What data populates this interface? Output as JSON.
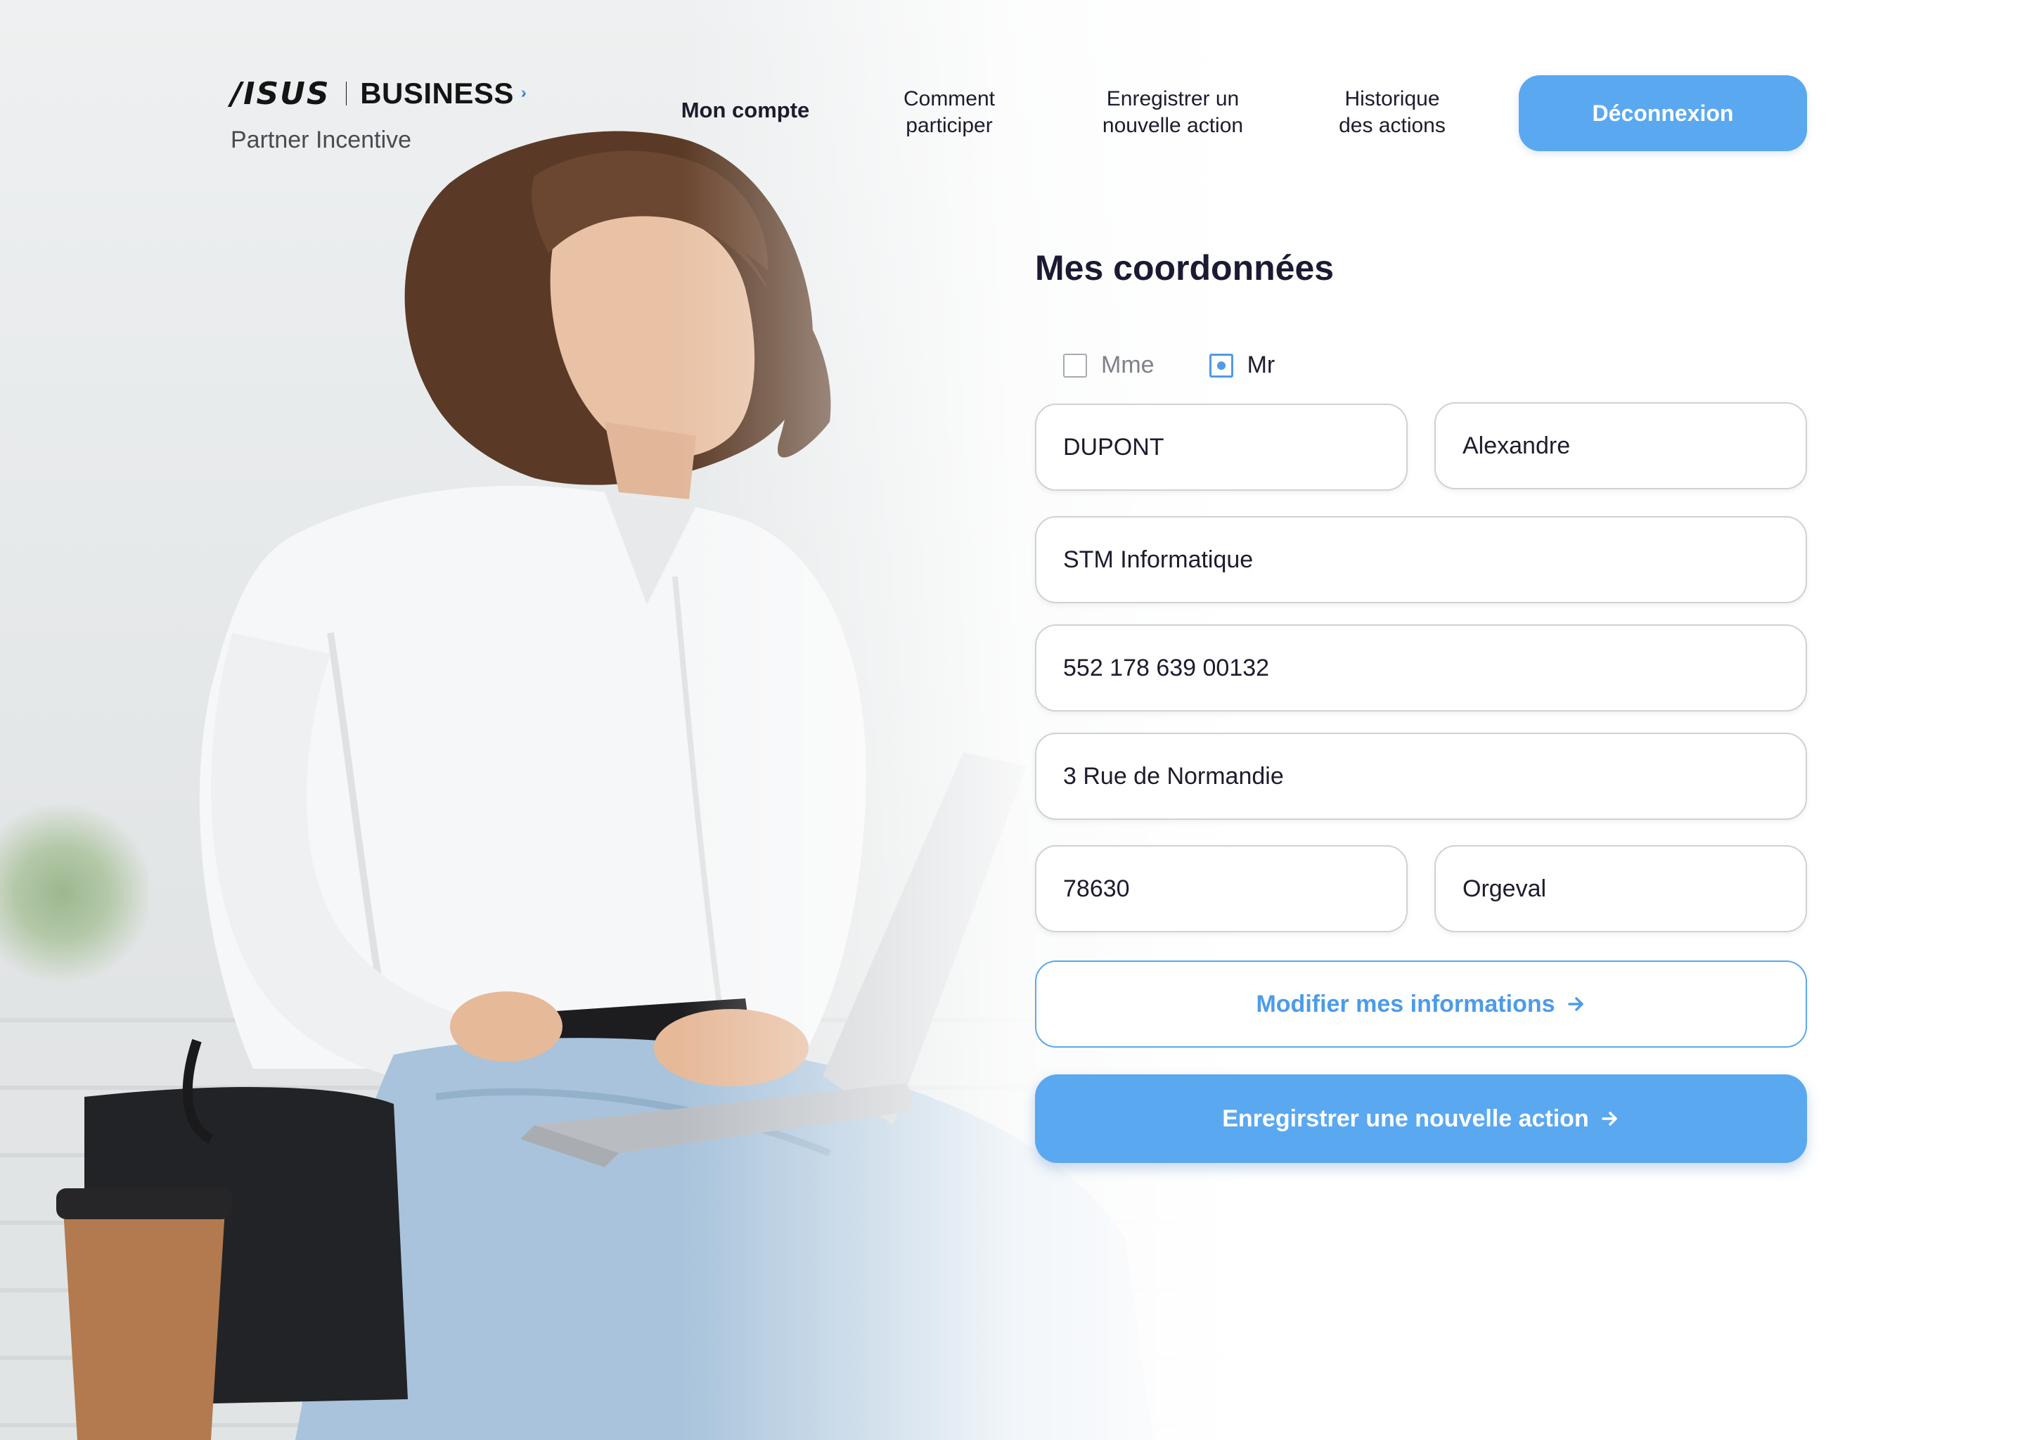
{
  "brand": {
    "logo_mark": "/ISUS",
    "logo_name": "BUSINESS",
    "subtitle": "Partner Incentive",
    "chevron_color": "#2b78d8"
  },
  "nav": {
    "items": [
      {
        "label_line1": "Mon compte",
        "label_line2": "",
        "active": true
      },
      {
        "label_line1": "Comment",
        "label_line2": "participer",
        "active": false
      },
      {
        "label_line1": "Enregistrer un",
        "label_line2": "nouvelle action",
        "active": false
      },
      {
        "label_line1": "Historique",
        "label_line2": "des actions",
        "active": false
      }
    ],
    "logout_label": "Déconnexion"
  },
  "form": {
    "title": "Mes coordonnées",
    "civility": {
      "options": [
        "Mme",
        "Mr"
      ],
      "selected": "Mr"
    },
    "fields": {
      "last_name": "DUPONT",
      "first_name": "Alexandre",
      "company": "STM Informatique",
      "siret": "552 178 639 00132",
      "address": "3 Rue de Normandie",
      "postal_code": "78630",
      "city": "Orgeval"
    },
    "edit_button": "Modifier mes informations",
    "primary_button": "Enregirstrer une nouvelle action"
  },
  "colors": {
    "accent": "#5aa8f0",
    "accent_dark": "#4d9be9",
    "text": "#1c1c2e"
  },
  "icons": {
    "arrow": "arrow-right-icon",
    "checkbox": "checkbox-icon",
    "radio_selected": "radio-selected-icon"
  }
}
